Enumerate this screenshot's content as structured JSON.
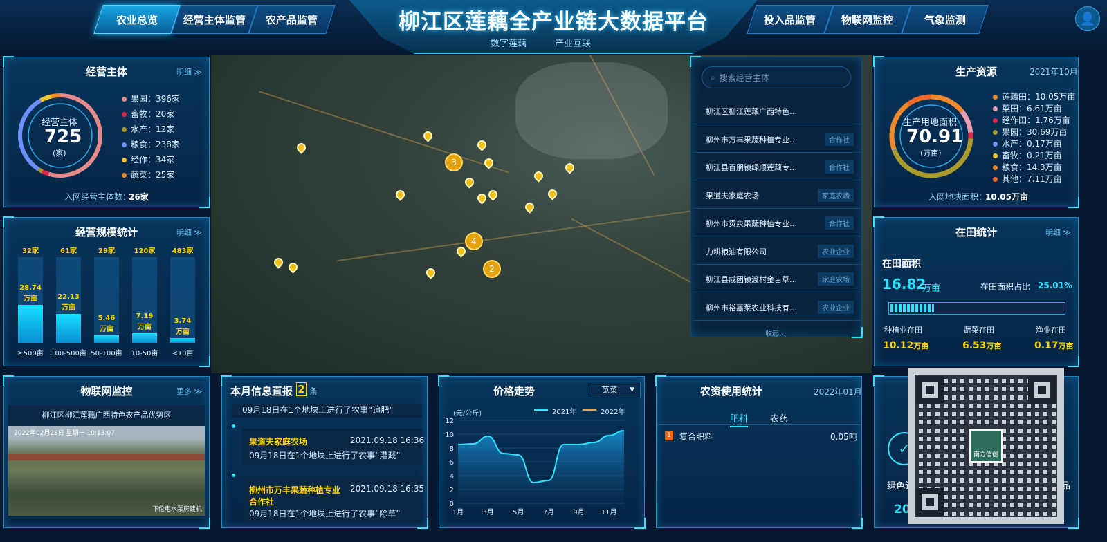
{
  "header": {
    "title": "柳江区莲藕全产业链大数据平台",
    "subtitle_left": "数字莲藕",
    "subtitle_right": "产业互联",
    "nav_left": [
      "农业总览",
      "经营主体监管",
      "农产品监管"
    ],
    "nav_right": [
      "投入品监管",
      "物联网监控",
      "气象监测"
    ],
    "user_icon": "user-icon"
  },
  "entity": {
    "title": "经营主体",
    "more": "明细 ≫",
    "donut_label": "经营主体",
    "donut_value": "725",
    "donut_unit": "(家)",
    "items": [
      {
        "label": "果园：",
        "value": "396家",
        "color": "#e58a8a",
        "share": 396
      },
      {
        "label": "畜牧：",
        "value": "20家",
        "color": "#e0284a",
        "share": 20
      },
      {
        "label": "水产：",
        "value": "12家",
        "color": "#a89b2c",
        "share": 12
      },
      {
        "label": "粮食：",
        "value": "238家",
        "color": "#6d8fff",
        "share": 238
      },
      {
        "label": "经作：",
        "value": "34家",
        "color": "#f1c62d",
        "share": 34
      },
      {
        "label": "蔬菜：",
        "value": "25家",
        "color": "#f08a2a",
        "share": 25
      }
    ],
    "footer_label": "入网经营主体数：",
    "footer_value": "26家"
  },
  "scale": {
    "title": "经营规模统计",
    "more": "明细 ≫",
    "bars": [
      {
        "count": "32家",
        "value": "28.74",
        "unit": "万亩",
        "label": "≥500亩",
        "fill": 0.44
      },
      {
        "count": "61家",
        "value": "22.13",
        "unit": "万亩",
        "label": "100-500亩",
        "fill": 0.34
      },
      {
        "count": "29家",
        "value": "5.46",
        "unit": "万亩",
        "label": "50-100亩",
        "fill": 0.09
      },
      {
        "count": "120家",
        "value": "7.19",
        "unit": "万亩",
        "label": "10-50亩",
        "fill": 0.11
      },
      {
        "count": "483家",
        "value": "3.74",
        "unit": "万亩",
        "label": "<10亩",
        "fill": 0.06
      }
    ]
  },
  "iot": {
    "title": "物联网监控",
    "more": "更多 ≫",
    "video_title": "柳江区柳江莲藕广西特色农产品优势区",
    "video_time": "2022年02月28日  星期一  10:13:07",
    "video_caption": "下伦电水泵房建机"
  },
  "news": {
    "title": "本月信息直报",
    "count": "2",
    "unit": "条",
    "top_text": "09月18日在1个地块上进行了农事“追肥”",
    "items": [
      {
        "name": "果道夫家庭农场",
        "time": "2021.09.18 16:36",
        "text": "09月18日在1个地块上进行了农事“灌溉”"
      },
      {
        "name": "柳州市万丰果蔬种植专业合作社",
        "time": "2021.09.18 16:35",
        "text": "09月18日在1个地块上进行了农事“除草”"
      }
    ]
  },
  "price": {
    "title": "价格走势",
    "select": "苋菜",
    "ylabel": "(元/公斤)",
    "legend": [
      "2021年",
      "2022年"
    ],
    "chart_data": {
      "type": "area",
      "x": [
        "1月",
        "2月",
        "3月",
        "4月",
        "5月",
        "6月",
        "7月",
        "8月",
        "9月",
        "10月",
        "11月",
        "12月"
      ],
      "x_ticks": [
        "1月",
        "3月",
        "5月",
        "7月",
        "9月",
        "11月"
      ],
      "y_ticks": [
        "0",
        "2",
        "4",
        "6",
        "8",
        "10",
        "12"
      ],
      "ylim": [
        0,
        12
      ],
      "series": [
        {
          "name": "2021年",
          "values": [
            8.5,
            8.6,
            9.7,
            7.2,
            7.0,
            3.0,
            3.3,
            8.5,
            8.5,
            8.8,
            9.8,
            10.5
          ]
        }
      ]
    }
  },
  "agri": {
    "title": "农资使用统计",
    "date": "2022年01月",
    "tabs": [
      "肥料",
      "农药"
    ],
    "rank": "1",
    "item": "复合肥料",
    "value": "0.05吨"
  },
  "resources": {
    "title": "生产资源",
    "date": "2021年10月",
    "donut_label": "生产用地面积",
    "donut_value": "70.91",
    "donut_unit": "(万亩)",
    "items": [
      {
        "label": "莲藕田：",
        "value": "10.05万亩",
        "color": "#f08a2a"
      },
      {
        "label": "菜田：",
        "value": "6.61万亩",
        "color": "#e8a0b0"
      },
      {
        "label": "经作田：",
        "value": "1.76万亩",
        "color": "#e0284a"
      },
      {
        "label": "果园：",
        "value": "30.69万亩",
        "color": "#a89b2c"
      },
      {
        "label": "水产：",
        "value": "0.17万亩",
        "color": "#6d8fff"
      },
      {
        "label": "畜牧：",
        "value": "0.21万亩",
        "color": "#f1c62d"
      },
      {
        "label": "粮食：",
        "value": "14.3万亩",
        "color": "#f08a2a"
      },
      {
        "label": "其他：",
        "value": "7.11万亩",
        "color": "#f06a2a"
      }
    ],
    "footer_label": "入网地块面积：",
    "footer_value": "10.05万亩"
  },
  "field": {
    "title": "在田统计",
    "more": "明细 ≫",
    "area_label": "在田面积",
    "area_value": "16.82",
    "area_unit": "万亩",
    "ratio_label": "在田面积占比",
    "ratio_value": "25.01%",
    "ratio": 0.2501,
    "stats": [
      {
        "label": "种植业在田",
        "value": "10.12",
        "unit": "万亩"
      },
      {
        "label": "蔬菜在田",
        "value": "6.53",
        "unit": "万亩"
      },
      {
        "label": "渔业在田",
        "value": "0.17",
        "unit": "万亩"
      }
    ]
  },
  "cert": {
    "labels": [
      "绿色认证",
      "",
      "农产品"
    ],
    "values": [
      "20%",
      "",
      "1"
    ],
    "qr_brand": "南方信创"
  },
  "search": {
    "placeholder": "搜索经营主体",
    "collapse": "收起︿",
    "items": [
      {
        "name": "柳江区柳江莲藕广西特色…",
        "tag": ""
      },
      {
        "name": "柳州市万丰果蔬种植专业…",
        "tag": "合作社"
      },
      {
        "name": "柳江县百朋镇绿顺莲藕专…",
        "tag": "合作社"
      },
      {
        "name": "果道夫家庭农场",
        "tag": "家庭农场"
      },
      {
        "name": "柳州市贡泉果蔬种植专业…",
        "tag": "合作社"
      },
      {
        "name": "力耕粮油有限公司",
        "tag": "农业企业"
      },
      {
        "name": "柳江县成团镇渡村金吉草…",
        "tag": "家庭农场"
      },
      {
        "name": "柳州市裕嘉莱农业科技有…",
        "tag": "农业企业"
      }
    ]
  },
  "map": {
    "cluster_counts": [
      "3",
      "4",
      "2"
    ]
  }
}
